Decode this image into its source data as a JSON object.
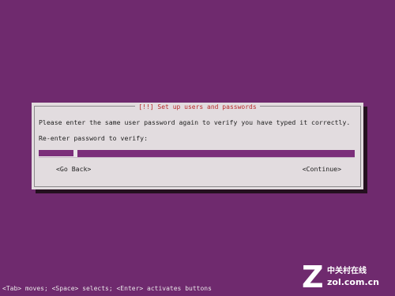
{
  "dialog": {
    "title": "[!!] Set up users and passwords",
    "instruction": "Please enter the same user password again to verify you have typed it correctly.",
    "prompt_label": "Re-enter password to verify:",
    "password_mask": "*********",
    "buttons": {
      "back_label": "<Go Back>",
      "continue_label": "<Continue>"
    }
  },
  "statusbar": {
    "help_text": "<Tab> moves; <Space> selects; <Enter> activates buttons"
  },
  "watermark": {
    "mark": "Z",
    "name": "中关村在线",
    "url": "zol.com.cn"
  },
  "colors": {
    "background": "#6f2a6e",
    "dialog": "#e2dcdf",
    "title_text": "#b82a2a",
    "field": "#7b2e7a"
  }
}
